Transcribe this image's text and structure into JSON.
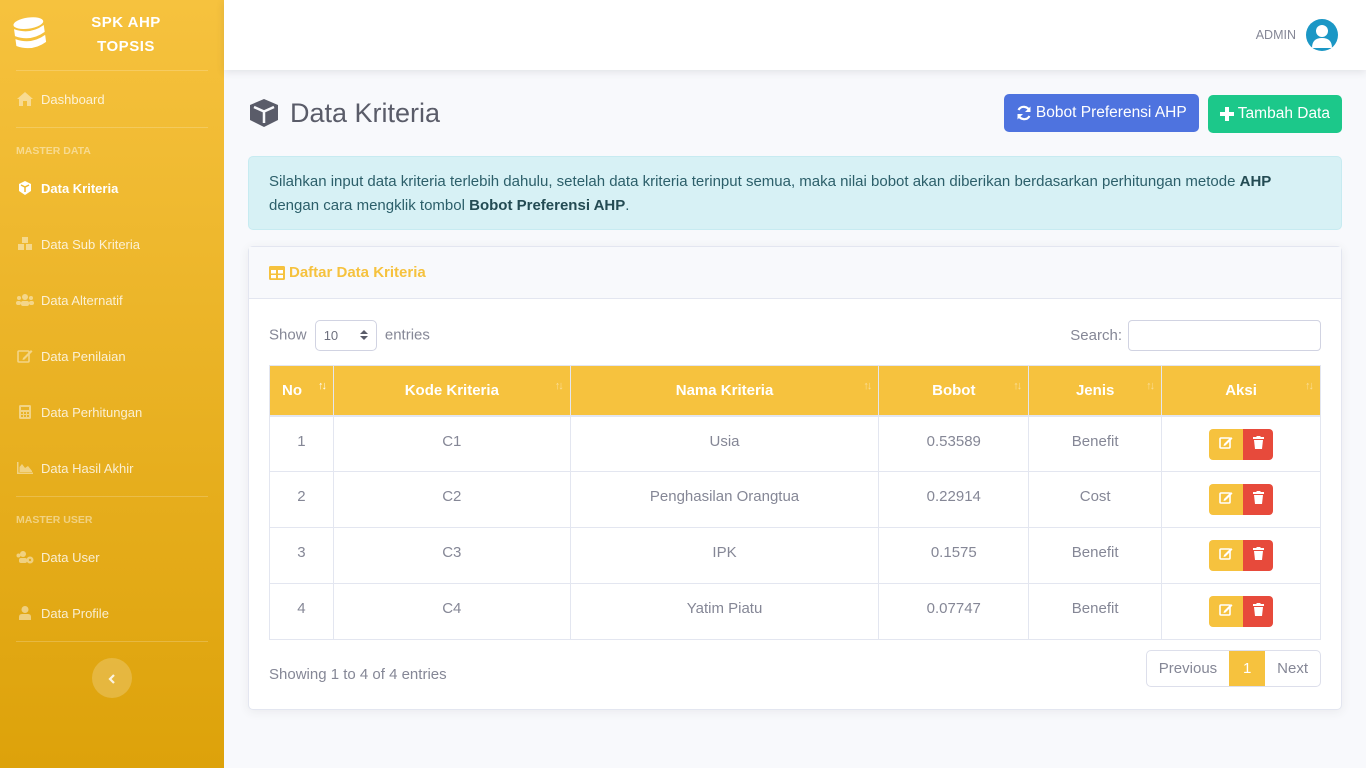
{
  "brand": {
    "line1": "SPK AHP",
    "line2": "TOPSIS",
    "icon": "database-icon"
  },
  "sidebar": {
    "dashboard": {
      "label": "Dashboard",
      "icon": "home-icon"
    },
    "heading_master_data": "MASTER DATA",
    "master_data_items": [
      {
        "label": "Data Kriteria",
        "icon": "cube-icon",
        "active": true
      },
      {
        "label": "Data Sub Kriteria",
        "icon": "cubes-icon",
        "active": false
      },
      {
        "label": "Data Alternatif",
        "icon": "users-icon",
        "active": false
      },
      {
        "label": "Data Penilaian",
        "icon": "edit-icon",
        "active": false
      },
      {
        "label": "Data Perhitungan",
        "icon": "calculator-icon",
        "active": false
      },
      {
        "label": "Data Hasil Akhir",
        "icon": "area-chart-icon",
        "active": false
      }
    ],
    "heading_master_user": "MASTER USER",
    "master_user_items": [
      {
        "label": "Data User",
        "icon": "users-cog-icon"
      },
      {
        "label": "Data Profile",
        "icon": "user-icon"
      }
    ],
    "toggle_icon": "chevron-left-icon"
  },
  "topbar": {
    "user_name": "ADMIN",
    "avatar_icon": "user-circle-icon"
  },
  "page": {
    "title": "Data Kriteria",
    "btn_bobot": "Bobot Preferensi AHP",
    "btn_tambah": "Tambah Data"
  },
  "alert": {
    "text1": "Silahkan input data kriteria terlebih dahulu, setelah data kriteria terinput semua, maka nilai bobot akan diberikan berdasarkan perhitungan metode ",
    "bold1": "AHP",
    "text2": " dengan cara mengklik tombol ",
    "bold2": "Bobot Preferensi AHP",
    "text3": "."
  },
  "card": {
    "title": "Daftar Data Kriteria",
    "show_label": "Show",
    "entries_label": "entries",
    "length_value": "10",
    "search_label": "Search:",
    "search_value": "",
    "columns": [
      "No",
      "Kode Kriteria",
      "Nama Kriteria",
      "Bobot",
      "Jenis",
      "Aksi"
    ],
    "rows": [
      {
        "no": "1",
        "kode": "C1",
        "nama": "Usia",
        "bobot": "0.53589",
        "jenis": "Benefit"
      },
      {
        "no": "2",
        "kode": "C2",
        "nama": "Penghasilan Orangtua",
        "bobot": "0.22914",
        "jenis": "Cost"
      },
      {
        "no": "3",
        "kode": "C3",
        "nama": "IPK",
        "bobot": "0.1575",
        "jenis": "Benefit"
      },
      {
        "no": "4",
        "kode": "C4",
        "nama": "Yatim Piatu",
        "bobot": "0.07747",
        "jenis": "Benefit"
      }
    ],
    "info": "Showing 1 to 4 of 4 entries",
    "pager": {
      "previous": "Previous",
      "current": "1",
      "next": "Next"
    }
  },
  "colors": {
    "warning": "#f6c23e",
    "danger": "#e74a3b",
    "primary": "#4e73df",
    "success": "#1cc88a",
    "info_bg": "#d7f1f5"
  }
}
